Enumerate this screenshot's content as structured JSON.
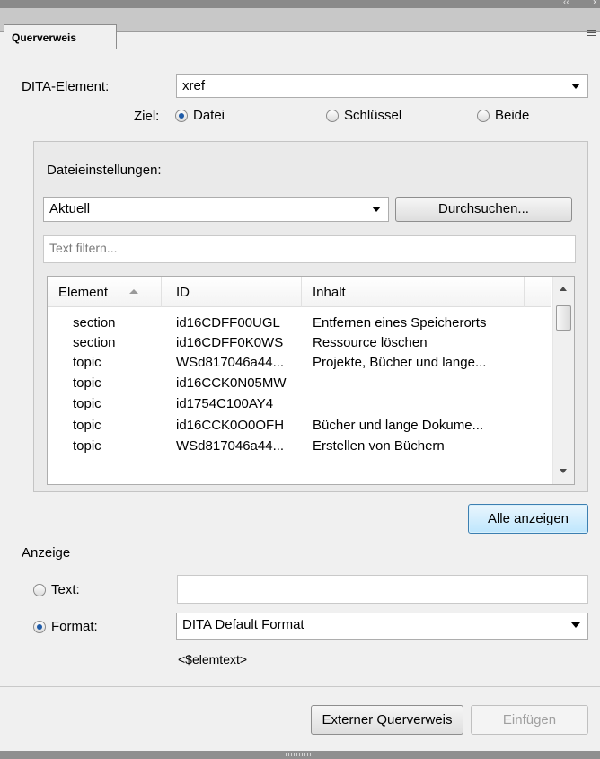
{
  "panel": {
    "tab_label": "Querverweis",
    "collapse_glyph": "‹‹",
    "close_glyph": "x"
  },
  "dita": {
    "label": "DITA-Element:",
    "value": "xref"
  },
  "ziel": {
    "label": "Ziel:",
    "options": [
      {
        "label": "Datei",
        "selected": true
      },
      {
        "label": "Schlüssel",
        "selected": false
      },
      {
        "label": "Beide",
        "selected": false
      }
    ]
  },
  "file_settings": {
    "heading": "Dateieinstellungen:",
    "file_value": "Aktuell",
    "browse_label": "Durchsuchen...",
    "filter_placeholder": "Text filtern..."
  },
  "table": {
    "columns": [
      "Element",
      "ID",
      "Inhalt"
    ],
    "rows": [
      {
        "element": "section",
        "id": "id16CDFF00UGL",
        "inhalt": "Entfernen eines Speicherorts"
      },
      {
        "element": "section",
        "id": "id16CDFF0K0WS",
        "inhalt": "Ressource löschen"
      },
      {
        "element": "topic",
        "id": "WSd817046a44...",
        "inhalt": "Projekte, Bücher und lange..."
      },
      {
        "element": "topic",
        "id": "id16CCK0N05MW",
        "inhalt": ""
      },
      {
        "element": "topic",
        "id": "id1754C100AY4",
        "inhalt": ""
      },
      {
        "element": "topic",
        "id": "id16CCK0O0OFH",
        "inhalt": "Bücher und lange Dokume..."
      },
      {
        "element": "topic",
        "id": "WSd817046a44...",
        "inhalt": "Erstellen von Büchern"
      }
    ]
  },
  "show_all_label": "Alle anzeigen",
  "anzeige": {
    "heading": "Anzeige",
    "text_label": "Text:",
    "text_value": "",
    "format_label": "Format:",
    "format_value": "DITA Default Format",
    "format_preview": "<$elemtext>"
  },
  "footer": {
    "external_label": "Externer Querverweis",
    "insert_label": "Einfügen"
  }
}
